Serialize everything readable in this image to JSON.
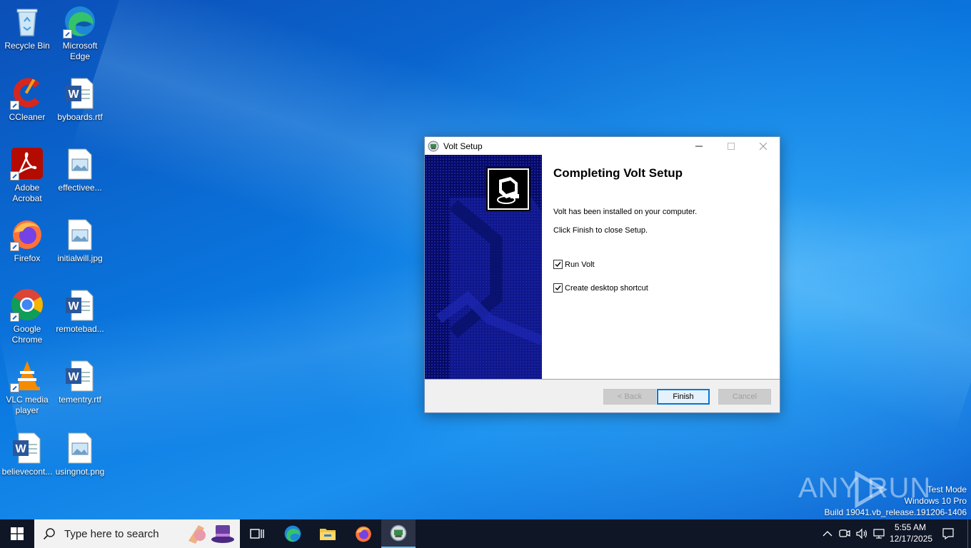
{
  "desktop": {
    "icons": [
      {
        "label": "Recycle Bin",
        "icon": "recycle-bin-icon"
      },
      {
        "label": "Microsoft Edge",
        "icon": "edge-icon"
      },
      {
        "label": "CCleaner",
        "icon": "ccleaner-icon"
      },
      {
        "label": "byboards.rtf",
        "icon": "word-doc-icon"
      },
      {
        "label": "Adobe Acrobat",
        "icon": "acrobat-icon"
      },
      {
        "label": "effectivee...",
        "icon": "image-file-icon"
      },
      {
        "label": "Firefox",
        "icon": "firefox-icon"
      },
      {
        "label": "initialwill.jpg",
        "icon": "image-file-icon"
      },
      {
        "label": "Google Chrome",
        "icon": "chrome-icon"
      },
      {
        "label": "remotebad...",
        "icon": "word-doc-icon"
      },
      {
        "label": "VLC media player",
        "icon": "vlc-icon"
      },
      {
        "label": "tementry.rtf",
        "icon": "word-doc-icon"
      },
      {
        "label": "believecont...",
        "icon": "word-doc-icon"
      },
      {
        "label": "usingnot.png",
        "icon": "image-file-icon"
      }
    ]
  },
  "dialog": {
    "title": "Volt Setup",
    "heading": "Completing Volt Setup",
    "line1": "Volt has been installed on your computer.",
    "line2": "Click Finish to close Setup.",
    "checkboxes": [
      {
        "label": "Run Volt",
        "checked": true
      },
      {
        "label": "Create desktop shortcut",
        "checked": true
      }
    ],
    "buttons": {
      "back": "< Back",
      "finish": "Finish",
      "cancel": "Cancel"
    }
  },
  "watermark": {
    "brand": "ANY RUN",
    "test_mode": "Test Mode",
    "edition": "Windows 10 Pro",
    "build": "Build 19041.vb_release.191206-1406"
  },
  "taskbar": {
    "search_placeholder": "Type here to search",
    "apps": [
      "task-view-icon",
      "edge-icon",
      "file-explorer-icon",
      "firefox-icon",
      "volt-setup-icon"
    ],
    "clock": {
      "time": "5:55 AM",
      "date": "12/17/2025"
    }
  },
  "colors": {
    "desktop_blue": "#0a78e0",
    "taskbar": "#0f1626",
    "side_panel": "#050a63",
    "primary_button_border": "#0078d7"
  }
}
